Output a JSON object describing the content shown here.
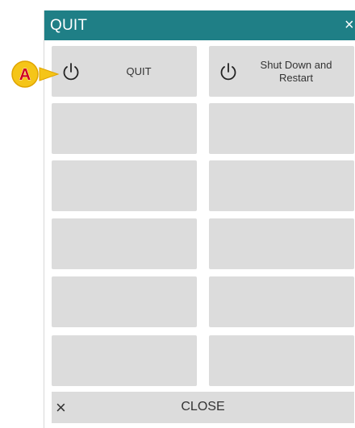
{
  "dialog": {
    "title": "QUIT",
    "title_close_glyph": "×",
    "colors": {
      "titlebar": "#1f7f86",
      "button_bg": "#dcdcdc"
    }
  },
  "buttons": [
    {
      "label": "QUIT",
      "icon": "power-icon"
    },
    {
      "label": "Shut Down and Restart",
      "icon": "power-icon"
    }
  ],
  "footer": {
    "close_glyph": "×",
    "close_label": "CLOSE"
  },
  "callout": {
    "letter": "A",
    "colors": {
      "fill": "#f5c518",
      "letter": "#d0021b"
    }
  }
}
